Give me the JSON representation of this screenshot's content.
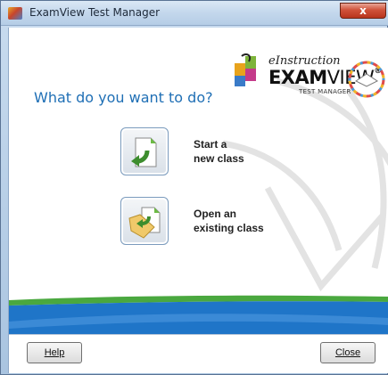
{
  "window": {
    "title": "ExamView Test Manager",
    "close_glyph": "x"
  },
  "logo": {
    "einstruction": "eInstruction",
    "exam": "EXAM",
    "view": "VIEW",
    "reg": "®",
    "subtitle": "TEST MANAGER"
  },
  "main": {
    "heading": "What do you want to do?",
    "actions": [
      {
        "line1": "Start a",
        "line2": "new class",
        "icon": "new-document-icon"
      },
      {
        "line1": "Open an",
        "line2": "existing class",
        "icon": "open-folder-icon"
      }
    ]
  },
  "footer": {
    "help_label": "Help",
    "close_label": "Close"
  },
  "colors": {
    "heading": "#1f6fb5",
    "stripe_blue": "#1f75c8",
    "stripe_green": "#4aa83f"
  }
}
